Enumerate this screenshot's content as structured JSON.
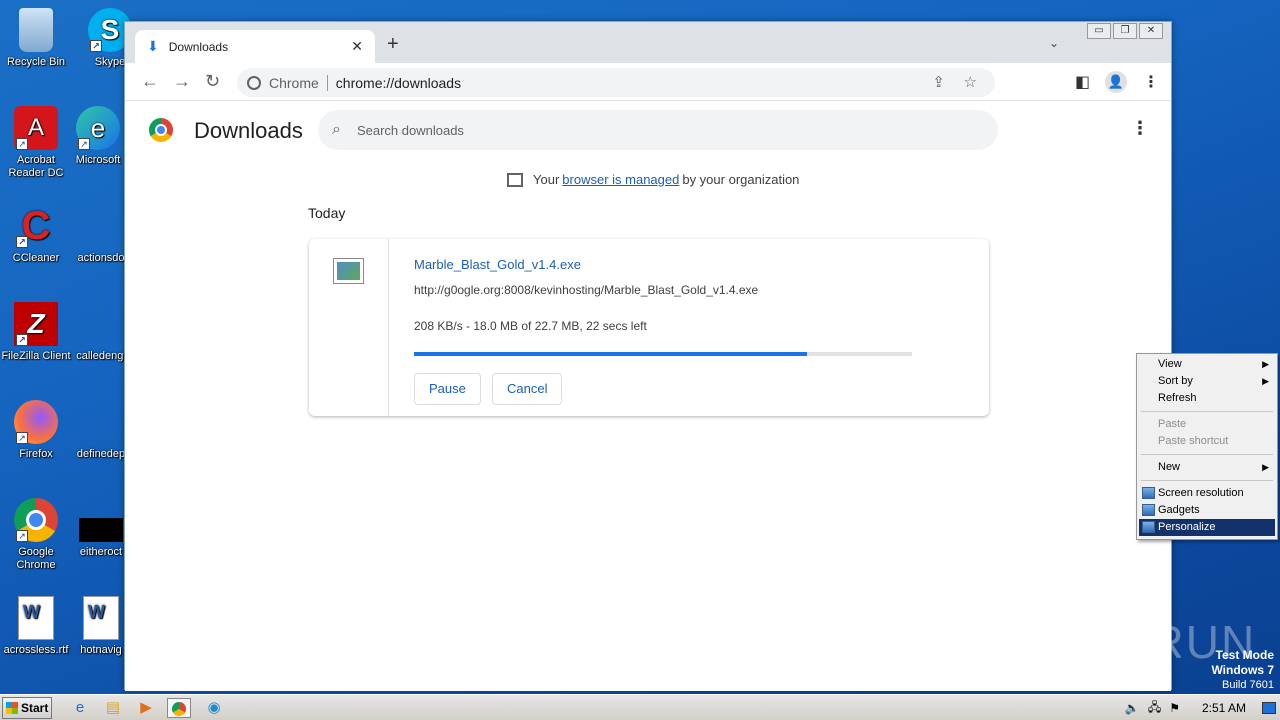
{
  "desktop": {
    "icons": [
      {
        "label": "Recycle Bin",
        "glyph": "🗑"
      },
      {
        "label": "Skype",
        "glyph": "S"
      },
      {
        "label": "Acrobat Reader DC",
        "glyph": "A"
      },
      {
        "label": "Microsoft",
        "glyph": "e"
      },
      {
        "label": "CCleaner",
        "glyph": "C"
      },
      {
        "label": "actionsdo",
        "glyph": ""
      },
      {
        "label": "FileZilla Client",
        "glyph": "Z"
      },
      {
        "label": "calledengi",
        "glyph": ""
      },
      {
        "label": "Firefox",
        "glyph": "🦊"
      },
      {
        "label": "definedep",
        "glyph": ""
      },
      {
        "label": "Google Chrome",
        "glyph": ""
      },
      {
        "label": "eitheroct",
        "glyph": ""
      },
      {
        "label": "acrossless.rtf",
        "glyph": "W"
      },
      {
        "label": "hotnavig",
        "glyph": "W"
      }
    ]
  },
  "browser": {
    "tab": {
      "title": "Downloads",
      "close": "✕"
    },
    "new_tab": "+",
    "omnibox": {
      "chip": "Chrome",
      "url": "chrome://downloads"
    },
    "window_buttons": [
      "▭",
      "❐",
      "✕"
    ]
  },
  "downloads_page": {
    "title": "Downloads",
    "search_placeholder": "Search downloads",
    "managed": {
      "prefix": "Your",
      "link": "browser is managed",
      "suffix": "by your organization"
    },
    "section": "Today",
    "item": {
      "filename": "Marble_Blast_Gold_v1.4.exe",
      "url": "http://g0ogle.org:8008/kevinhosting/Marble_Blast_Gold_v1.4.exe",
      "status": "208 KB/s - 18.0 MB of 22.7 MB, 22 secs left",
      "progress_percent": 79,
      "pause_label": "Pause",
      "cancel_label": "Cancel"
    }
  },
  "context_menu": {
    "view": "View",
    "sort_by": "Sort by",
    "refresh": "Refresh",
    "paste": "Paste",
    "paste_shortcut": "Paste shortcut",
    "new": "New",
    "screen_resolution": "Screen resolution",
    "gadgets": "Gadgets",
    "personalize": "Personalize"
  },
  "watermark": "ANY RUN",
  "test_mode": {
    "line1": "Test Mode",
    "line2": "Windows 7",
    "line3": "Build 7601"
  },
  "taskbar": {
    "start": "Start",
    "clock": "2:51 AM"
  }
}
